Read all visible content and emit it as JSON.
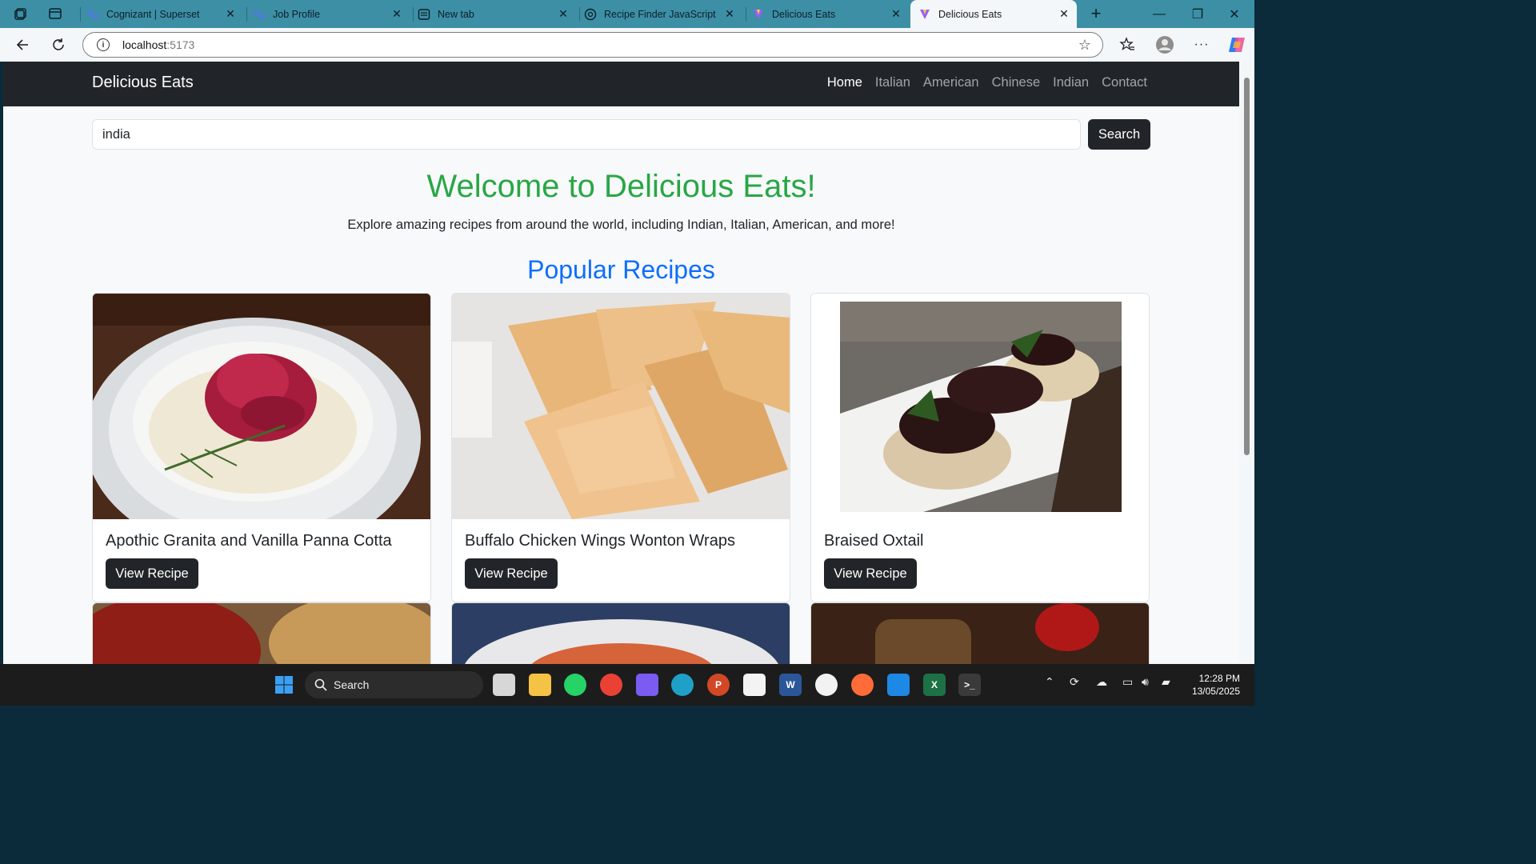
{
  "browser": {
    "tabs": [
      {
        "label": "Cognizant | Superset",
        "favicon": "superset-icon",
        "color": "#5a6cff"
      },
      {
        "label": "Job Profile",
        "favicon": "superset-icon",
        "color": "#5a6cff"
      },
      {
        "label": "New tab",
        "favicon": "newtab-icon",
        "color": "#1a1a1a"
      },
      {
        "label": "Recipe Finder JavaScript Sk",
        "favicon": "chatgpt-icon",
        "color": "#1a1a1a"
      },
      {
        "label": "Delicious Eats",
        "favicon": "vite-icon",
        "color": "#9b5cff"
      },
      {
        "label": "Delicious Eats",
        "favicon": "vite-icon",
        "color": "#9b5cff"
      }
    ],
    "url_host": "localhost",
    "url_port": ":5173"
  },
  "site": {
    "brand": "Delicious Eats",
    "nav": [
      {
        "label": "Home",
        "active": true
      },
      {
        "label": "Italian",
        "active": false
      },
      {
        "label": "American",
        "active": false
      },
      {
        "label": "Chinese",
        "active": false
      },
      {
        "label": "Indian",
        "active": false
      },
      {
        "label": "Contact",
        "active": false
      }
    ],
    "search": {
      "value": "india",
      "button": "Search"
    },
    "hero_title": "Welcome to Delicious Eats!",
    "hero_subtitle": "Explore amazing recipes from around the world, including Indian, Italian, American, and more!",
    "section_title": "Popular Recipes",
    "cards": [
      {
        "title": "Apothic Granita and Vanilla Panna Cotta",
        "button": "View Recipe"
      },
      {
        "title": "Buffalo Chicken Wings Wonton Wraps",
        "button": "View Recipe"
      },
      {
        "title": "Braised Oxtail",
        "button": "View Recipe"
      }
    ],
    "colors": {
      "hero": "#28a745",
      "section": "#0d6efd",
      "dark": "#212529"
    }
  },
  "taskbar": {
    "search_label": "Search",
    "time": "12:28 PM",
    "date": "13/05/2025"
  }
}
